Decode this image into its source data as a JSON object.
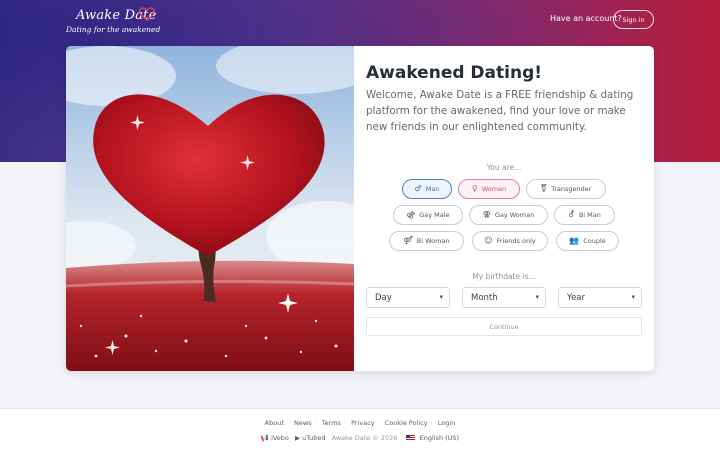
{
  "header": {
    "brand": "Awake Date",
    "tagline": "Dating for the awakened",
    "account_prompt": "Have an account?",
    "signin_label": "Sign in"
  },
  "main": {
    "title": "Awakened Dating!",
    "description": "Welcome, Awake Date is a FREE friendship & dating platform for the awakened, find your love or make new friends in our enlightened community.",
    "you_are_label": "You are...",
    "genders": [
      {
        "label": "Man",
        "icon": "male-icon",
        "symbol": "♂",
        "selected": true
      },
      {
        "label": "Woman",
        "icon": "female-icon",
        "symbol": "♀",
        "selected": true
      },
      {
        "label": "Transgender",
        "icon": "transgender-icon",
        "symbol": "⚧",
        "selected": false
      },
      {
        "label": "Gay Male",
        "icon": "gay-male-icon",
        "symbol": "⚣",
        "selected": false
      },
      {
        "label": "Gay Woman",
        "icon": "gay-woman-icon",
        "symbol": "⚢",
        "selected": false
      },
      {
        "label": "Bi Man",
        "icon": "bi-man-icon",
        "symbol": "⚦",
        "selected": false
      },
      {
        "label": "Bi Woman",
        "icon": "bi-woman-icon",
        "symbol": "⚤",
        "selected": false
      },
      {
        "label": "Friends only",
        "icon": "friend-icon",
        "symbol": "☺",
        "selected": false
      },
      {
        "label": "Couple",
        "icon": "couple-icon",
        "symbol": "👥",
        "selected": false
      }
    ],
    "birthdate_label": "My birthdate is...",
    "day_select": "Day",
    "month_select": "Month",
    "year_select": "Year",
    "continue_label": "Continue"
  },
  "footer": {
    "links": [
      "About",
      "News",
      "Terms",
      "Privacy",
      "Cookie Policy",
      "Login"
    ],
    "vebo": "iVebo",
    "utubed": "uTubed",
    "copyright": "Awake Date © 2026",
    "language": "English (US)"
  },
  "colors": {
    "accent_man": "#3a6ab5",
    "accent_woman": "#d24d8a",
    "header_gradient_start": "#3a2d86",
    "header_gradient_end": "#b51c3b"
  }
}
